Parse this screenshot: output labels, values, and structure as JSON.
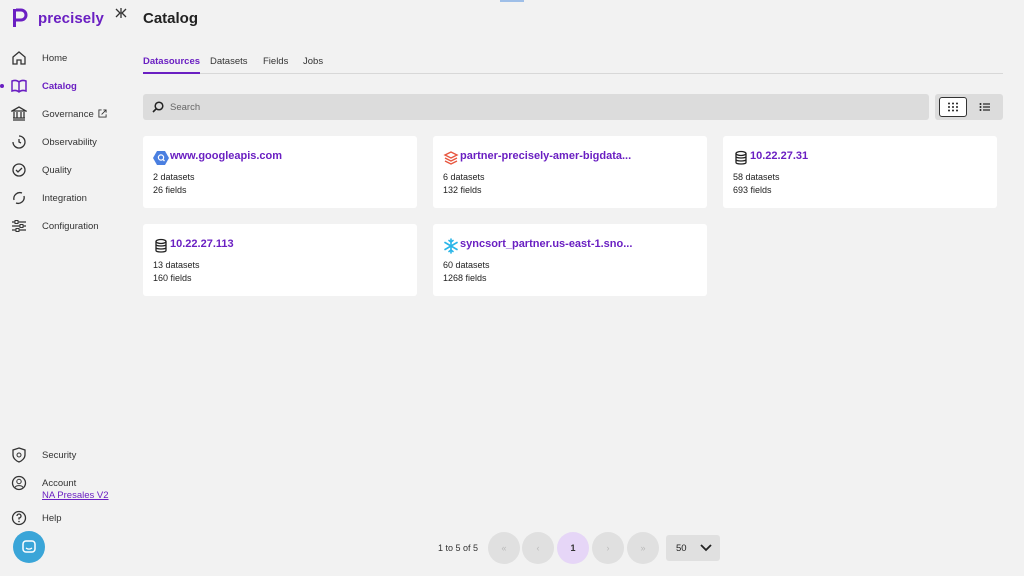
{
  "brand": {
    "name": "precisely"
  },
  "sidebar": {
    "items": [
      {
        "label": "Home"
      },
      {
        "label": "Catalog"
      },
      {
        "label": "Governance"
      },
      {
        "label": "Observability"
      },
      {
        "label": "Quality"
      },
      {
        "label": "Integration"
      },
      {
        "label": "Configuration"
      }
    ],
    "bottom": [
      {
        "label": "Security"
      },
      {
        "label": "Account",
        "sub": "NA Presales V2"
      },
      {
        "label": "Help"
      }
    ]
  },
  "header": {
    "title": "Catalog"
  },
  "tabs": [
    {
      "label": "Datasources",
      "active": true
    },
    {
      "label": "Datasets"
    },
    {
      "label": "Fields"
    },
    {
      "label": "Jobs"
    }
  ],
  "search": {
    "placeholder": "Search"
  },
  "datasources": [
    {
      "name": "www.googleapis.com",
      "datasets": "2 datasets",
      "fields": "26 fields",
      "icon": "bigquery-icon"
    },
    {
      "name": "partner-precisely-amer-bigdata...",
      "datasets": "6 datasets",
      "fields": "132 fields",
      "icon": "databricks-icon"
    },
    {
      "name": "10.22.27.31",
      "datasets": "58 datasets",
      "fields": "693 fields",
      "icon": "database-icon"
    },
    {
      "name": "10.22.27.113",
      "datasets": "13 datasets",
      "fields": "160 fields",
      "icon": "database-icon"
    },
    {
      "name": "syncsort_partner.us-east-1.sno...",
      "datasets": "60 datasets",
      "fields": "1268 fields",
      "icon": "snowflake-icon"
    }
  ],
  "pagination": {
    "info": "1 to 5 of 5",
    "current_page": "1",
    "page_size": "50"
  },
  "colors": {
    "accent": "#6a1fc2",
    "background": "#f2f2f2",
    "chat": "#3aa5d8"
  }
}
